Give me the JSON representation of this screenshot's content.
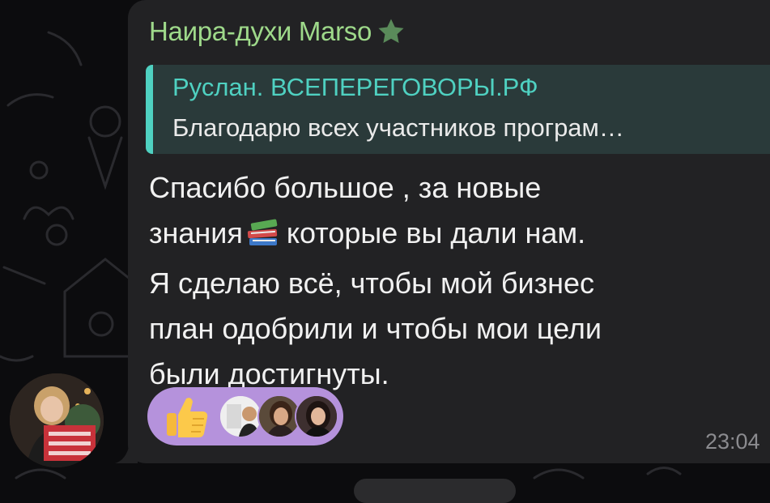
{
  "message": {
    "sender_name": "Наира-духи Marso",
    "reply": {
      "author": "Руслан. ВСЕПЕРЕГОВОРЫ.РФ",
      "text": "Благодарю всех участников програм…"
    },
    "lines": [
      "Спасибо большое , за новые",
      "знания",
      "которые вы дали нам.",
      "Я сделаю всё, чтобы мой бизнес",
      "план одобрили и чтобы мои цели",
      "были достигнуты."
    ],
    "inline_emoji": "books-emoji",
    "time": "23:04"
  },
  "reactions": {
    "emoji": "thumbs-up-icon",
    "reactor_count_shown": 3
  },
  "colors": {
    "background": "#0c0c0e",
    "bubble": "#222224",
    "sender_name": "#9ed98a",
    "reply_accent": "#4fd1c1",
    "reply_bg": "#2a3a3a",
    "reaction_pill": "#b592dc",
    "time": "#8b8b8f",
    "text": "#f1f1f1"
  }
}
